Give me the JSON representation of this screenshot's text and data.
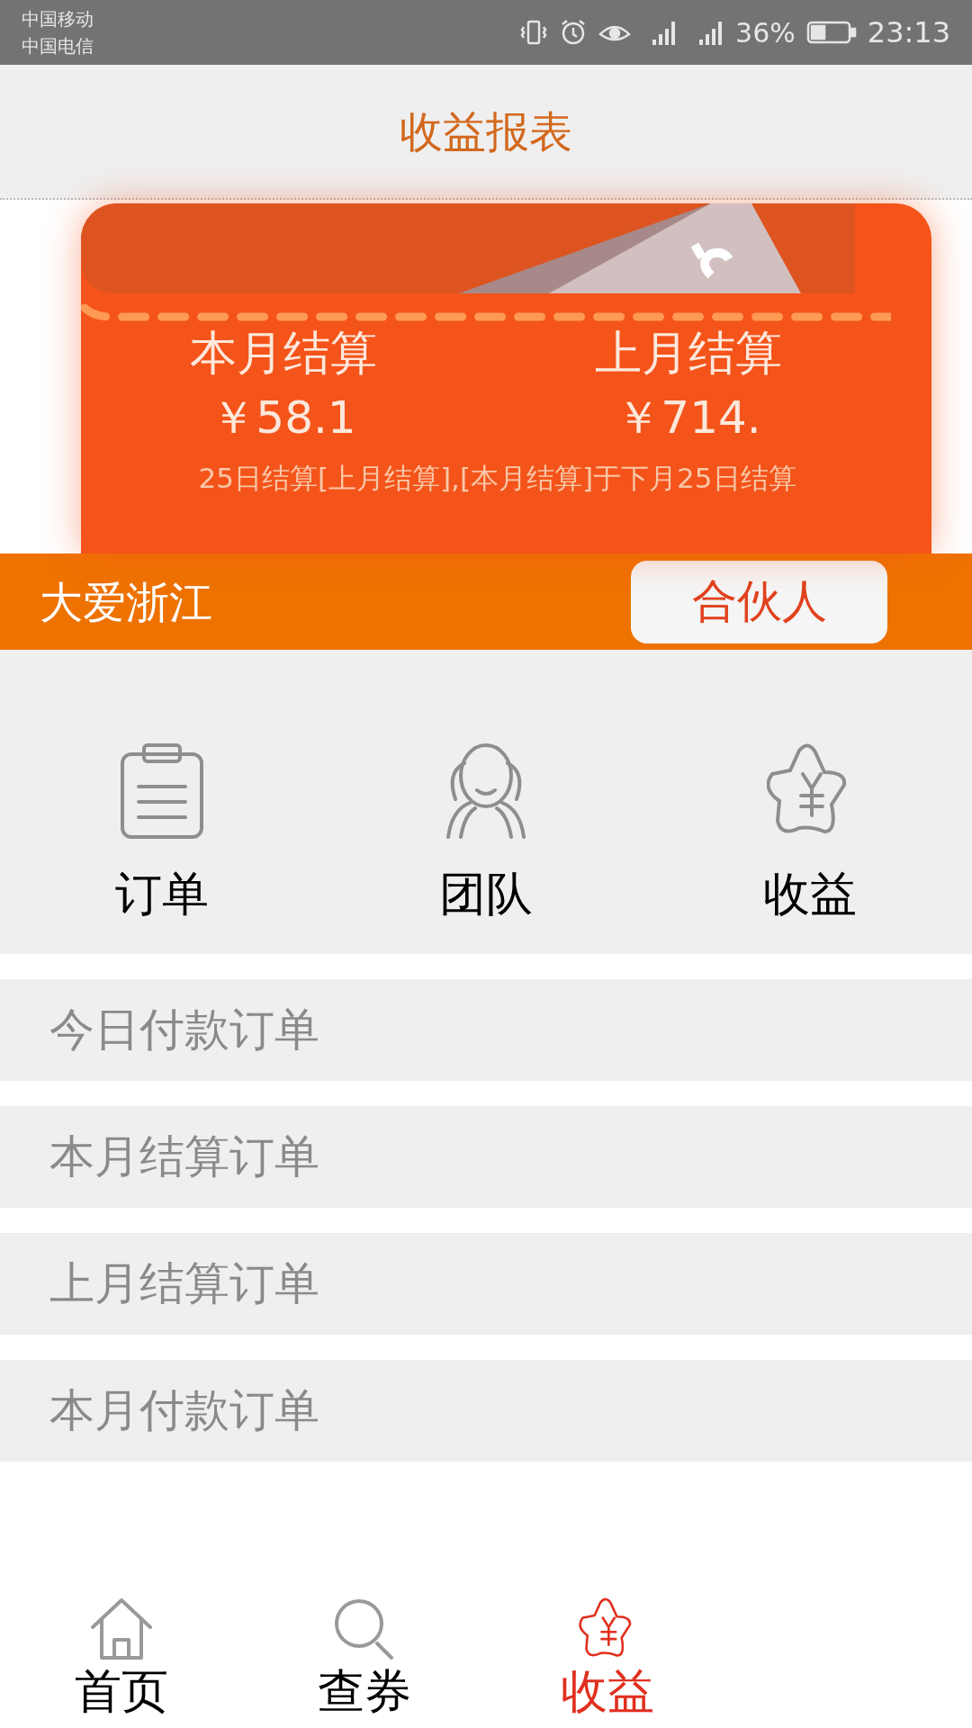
{
  "status_bar": {
    "carriers": [
      "中国移动",
      "中国电信"
    ],
    "battery": "36%",
    "time": "23:13"
  },
  "header": {
    "title": "收益报表"
  },
  "wallet": {
    "stats": [
      {
        "label": "本月结算",
        "value": "￥58.1"
      },
      {
        "label": "上月结算",
        "value": "￥714."
      }
    ],
    "note": "25日结算[上月结算],[本月结算]于下月25日结算"
  },
  "account": {
    "name": "大爱浙江",
    "role_button": "合伙人"
  },
  "shortcuts": [
    {
      "kind": "clipboard",
      "label": "订单"
    },
    {
      "kind": "team",
      "label": "团队"
    },
    {
      "kind": "income",
      "label": "收益"
    }
  ],
  "order_list": [
    "今日付款订单",
    "本月结算订单",
    "上月结算订单",
    "本月付款订单"
  ],
  "tab_bar": [
    {
      "kind": "home",
      "label": "首页",
      "selected": false
    },
    {
      "kind": "search",
      "label": "查券",
      "selected": false
    },
    {
      "kind": "income",
      "label": "收益",
      "selected": true
    }
  ]
}
